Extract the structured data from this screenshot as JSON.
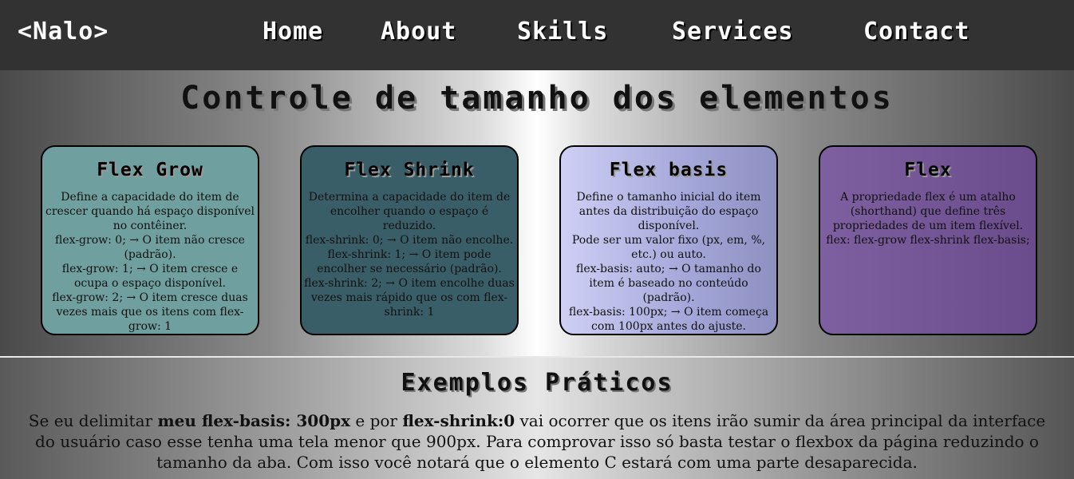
{
  "header": {
    "logo": "<Nalo>",
    "nav": [
      "Home",
      "About",
      "Skills",
      "Services",
      "Contact"
    ]
  },
  "section1": {
    "title": "Controle de tamanho dos elementos",
    "cards": [
      {
        "title": "Flex Grow",
        "lines": [
          "Define a capacidade do item de crescer quando há espaço disponível no contêiner.",
          "flex-grow: 0; → O item não cresce (padrão).",
          "flex-grow: 1; → O item cresce e ocupa o espaço disponível.",
          "flex-grow: 2; → O item cresce duas vezes mais que os itens com flex-grow: 1"
        ]
      },
      {
        "title": "Flex Shrink",
        "lines": [
          "Determina a capacidade do item de encolher quando o espaço é reduzido.",
          "flex-shrink: 0; → O item não encolhe.",
          "flex-shrink: 1; → O item pode encolher se necessário (padrão).",
          "flex-shrink: 2; → O item encolhe duas vezes mais rápido que os com flex-shrink: 1"
        ]
      },
      {
        "title": "Flex basis",
        "lines": [
          "Define o tamanho inicial do item antes da distribuição do espaço disponível.",
          "Pode ser um valor fixo (px, em, %, etc.) ou auto.",
          "flex-basis: auto; → O tamanho do item é baseado no conteúdo (padrão).",
          "flex-basis: 100px; → O item começa com 100px antes do ajuste."
        ]
      },
      {
        "title": "Flex",
        "lines": [
          "A propriedade flex é um atalho (shorthand) que define três propriedades de um item flexível.",
          "flex: flex-grow flex-shrink flex-basis;"
        ]
      }
    ]
  },
  "section2": {
    "title": "Exemplos Práticos",
    "text_1": "Se eu delimitar ",
    "bold_1": "meu flex-basis: 300px",
    "text_2": " e por ",
    "bold_2": "flex-shrink:0",
    "text_3": " vai ocorrer que os itens irão sumir da área principal da interface do usuário caso esse tenha uma tela menor que 900px. Para comprovar isso só basta testar o flexbox da página reduzindo o tamanho da aba. Com isso você notará que o elemento C estará com uma parte desaparecida."
  }
}
